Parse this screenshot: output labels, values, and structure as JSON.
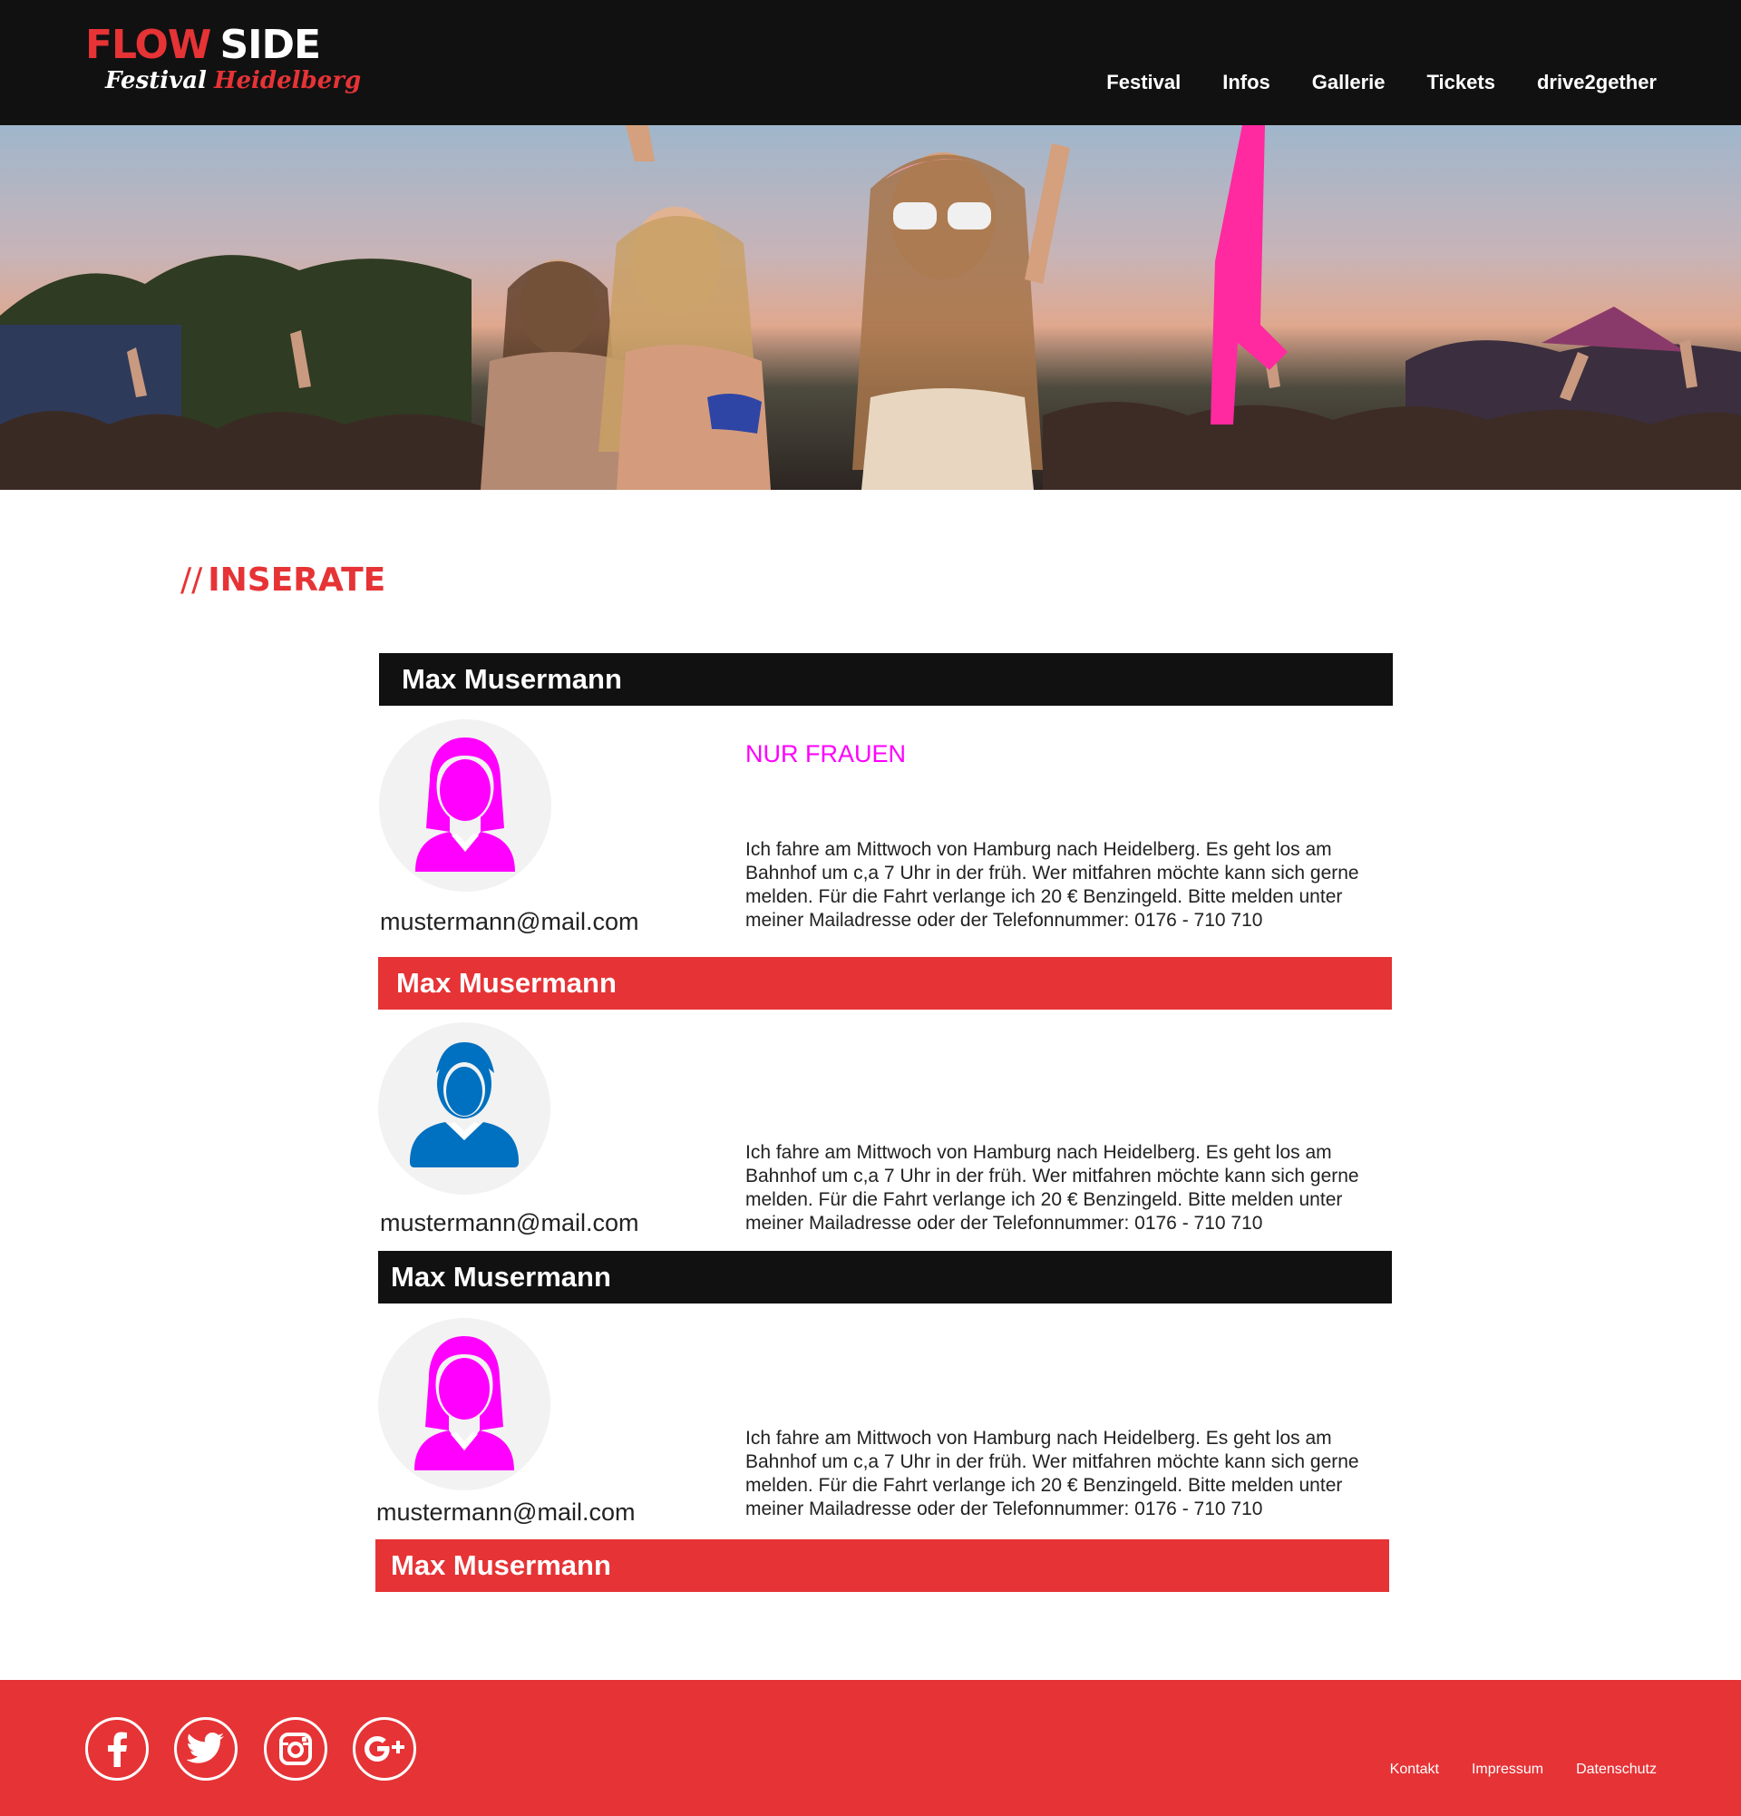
{
  "header": {
    "logo": {
      "line1_a": "FLOW",
      "line1_b": "SIDE",
      "line2_a": "Festival",
      "line2_b": "Heidelberg"
    },
    "nav": [
      "Festival",
      "Infos",
      "Gallerie",
      "Tickets",
      "drive2gether"
    ]
  },
  "section": {
    "slashes": "//",
    "title": "INSERATE"
  },
  "ads": [
    {
      "name": "Max Musermann",
      "bar_color": "#111111",
      "avatar": "female-user-icon",
      "avatar_color": "#ff00ff",
      "email": "mustermann@mail.com",
      "tag": "NUR FRAUEN",
      "text": "Ich fahre am Mittwoch von Hamburg nach Heidelberg. Es geht los am Bahnhof um c,a 7 Uhr in der früh. Wer mitfahren möchte kann sich gerne melden. Für die Fahrt verlange ich 20 € Benzingeld. Bitte melden unter meiner Mailadresse oder der Telefonnummer: 0176 - 710 710"
    },
    {
      "name": "Max Musermann",
      "bar_color": "#e63336",
      "avatar": "male-user-icon",
      "avatar_color": "#0070c0",
      "email": "mustermann@mail.com",
      "text": "Ich fahre am Mittwoch von Hamburg nach Heidelberg. Es geht los am Bahnhof um c,a 7 Uhr in der früh. Wer mitfahren möchte kann sich gerne melden. Für die Fahrt verlange ich 20 € Benzingeld. Bitte melden unter meiner Mailadresse oder der Telefonnummer: 0176 - 710 710"
    },
    {
      "name": "Max Musermann",
      "bar_color": "#111111",
      "avatar": "female-user-icon",
      "avatar_color": "#ff00ff",
      "email": "mustermann@mail.com",
      "text": "Ich fahre am Mittwoch von Hamburg nach Heidelberg. Es geht los am Bahnhof um c,a 7 Uhr in der früh. Wer mitfahren möchte kann sich gerne melden. Für die Fahrt verlange ich 20 € Benzingeld. Bitte melden unter meiner Mailadresse oder der Telefonnummer: 0176 - 710 710"
    },
    {
      "name": "Max Musermann",
      "bar_color": "#e63336"
    }
  ],
  "footer": {
    "social": [
      "facebook-icon",
      "twitter-icon",
      "instagram-icon",
      "google-plus-icon"
    ],
    "links": [
      "Kontakt",
      "Impressum",
      "Datenschutz"
    ]
  },
  "colors": {
    "brand_red": "#e63336",
    "dark": "#111111",
    "female": "#ff00ff",
    "male": "#0070c0"
  }
}
